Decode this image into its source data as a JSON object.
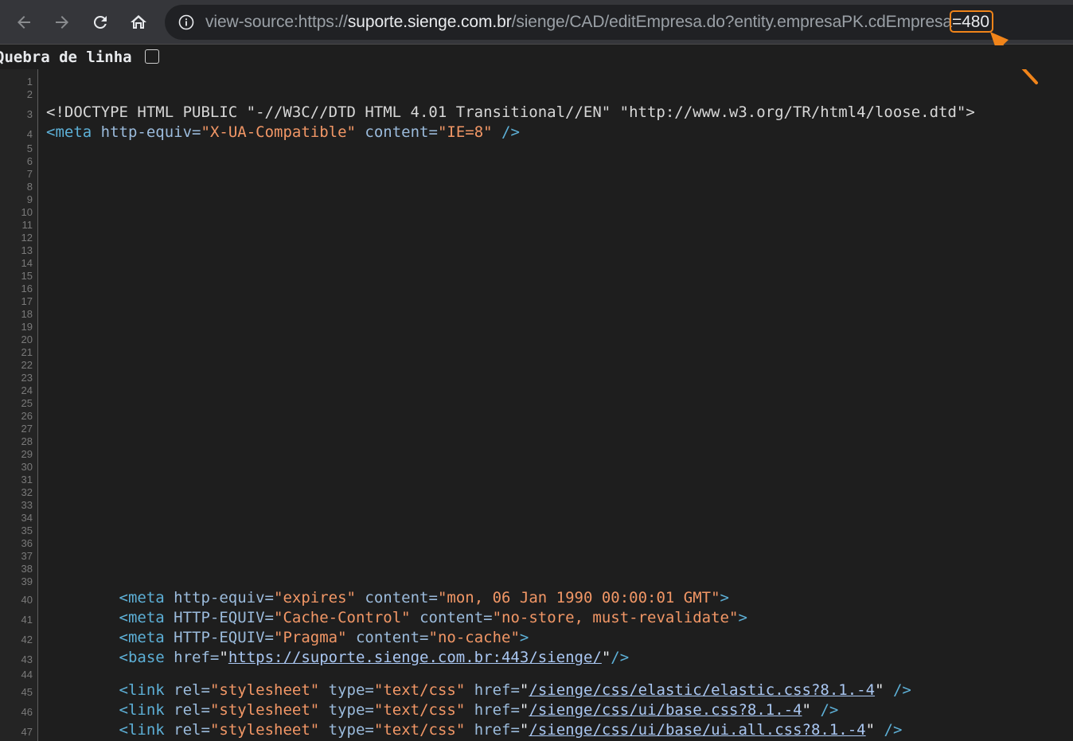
{
  "browser": {
    "url_prefix": "view-source:https://",
    "url_host": "suporte.sienge.com.br",
    "url_path": "/sienge/CAD/editEmpresa.do?entity.empresaPK.cdEmpresa",
    "url_highlight": "=480",
    "accent": "#f0841a"
  },
  "wrapbar": {
    "label": "Quebra de linha"
  },
  "gutter": {
    "line_numbers": [
      "1",
      "2",
      "3",
      "4",
      "5",
      "6",
      "7",
      "8",
      "9",
      "10",
      "11",
      "12",
      "13",
      "14",
      "15",
      "16",
      "17",
      "18",
      "19",
      "20",
      "21",
      "22",
      "23",
      "24",
      "25",
      "26",
      "27",
      "28",
      "29",
      "30",
      "31",
      "32",
      "33",
      "34",
      "35",
      "36",
      "37",
      "38",
      "39",
      "40",
      "41",
      "42",
      "43",
      "44",
      "45",
      "46",
      "47"
    ]
  },
  "code": {
    "line3": {
      "text": "<!DOCTYPE HTML PUBLIC \"-//W3C//DTD HTML 4.01 Transitional//EN\" \"http://www.w3.org/TR/html4/loose.dtd\">"
    },
    "line4": {
      "open": "<meta",
      "a1": "http-equiv=",
      "v1": "\"X-UA-Compatible\"",
      "a2": "content=",
      "v2": "\"IE=8\"",
      "close": "/>"
    },
    "line40": {
      "open": "<meta",
      "a1": "http-equiv=",
      "v1": "\"expires\"",
      "a2": "content=",
      "v2": "\"mon, 06 Jan 1990 00:00:01 GMT\"",
      "close": ">"
    },
    "line41": {
      "open": "<meta",
      "a1": "HTTP-EQUIV=",
      "v1": "\"Cache-Control\"",
      "a2": "content=",
      "v2": "\"no-store, must-revalidate\"",
      "close": ">"
    },
    "line42": {
      "open": "<meta",
      "a1": "HTTP-EQUIV=",
      "v1": "\"Pragma\"",
      "a2": "content=",
      "v2": "\"no-cache\"",
      "close": ">"
    },
    "line43": {
      "open": "<base",
      "a1": "href=",
      "q1": "\"",
      "link": "https://suporte.sienge.com.br:443/sienge/",
      "q2": "\"",
      "close": "/>"
    },
    "line45": {
      "open": "<link",
      "a1": "rel=",
      "v1": "\"stylesheet\"",
      "a2": "type=",
      "v2": "\"text/css\"",
      "a3": "href=",
      "q1": "\"",
      "link": "/sienge/css/elastic/elastic.css?8.1.-4",
      "q2": "\"",
      "close": "/>"
    },
    "line46": {
      "open": "<link",
      "a1": "rel=",
      "v1": "\"stylesheet\"",
      "a2": "type=",
      "v2": "\"text/css\"",
      "a3": "href=",
      "q1": "\"",
      "link": "/sienge/css/ui/base.css?8.1.-4",
      "q2": "\"",
      "close": "/>"
    },
    "line47": {
      "open": "<link",
      "a1": "rel=",
      "v1": "\"stylesheet\"",
      "a2": "type=",
      "v2": "\"text/css\"",
      "a3": "href=",
      "q1": "\"",
      "link": "/sienge/css/ui/base/ui.all.css?8.1.-4",
      "q2": "\"",
      "close": "/>"
    }
  }
}
